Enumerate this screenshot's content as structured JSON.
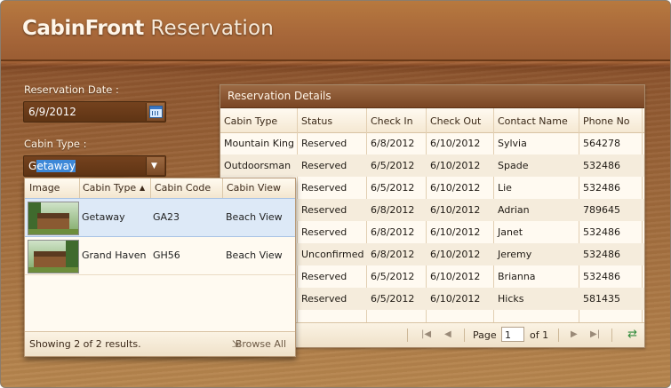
{
  "app": {
    "title_brand": "CabinFront",
    "title_rest": " Reservation"
  },
  "form": {
    "date_label": "Reservation Date :",
    "date_value": "6/9/2012",
    "cabin_label": "Cabin Type :",
    "cabin_value_prefix": "G",
    "cabin_value_selected": "etaway"
  },
  "dropdown": {
    "columns": [
      "Image",
      "Cabin Type",
      "Cabin Code",
      "Cabin View"
    ],
    "sort_icon": "sort-ascending-icon",
    "rows": [
      {
        "type": "Getaway",
        "code": "GA23",
        "view": "Beach View"
      },
      {
        "type": "Grand Haven",
        "code": "GH56",
        "view": "Beach View"
      }
    ],
    "status": "Showing 2 of 2 results.",
    "browse_label": "Browse All"
  },
  "panel": {
    "title": "Reservation Details",
    "columns": [
      "Cabin Type",
      "Status",
      "Check In",
      "Check Out",
      "Contact Name",
      "Phone No"
    ],
    "rows": [
      {
        "cabin": "Mountain King",
        "status": "Reserved",
        "in": "6/8/2012",
        "out": "6/10/2012",
        "contact": "Sylvia",
        "phone": "564278"
      },
      {
        "cabin": "Outdoorsman",
        "status": "Reserved",
        "in": "6/5/2012",
        "out": "6/10/2012",
        "contact": "Spade",
        "phone": "532486"
      },
      {
        "cabin": "",
        "status": "Reserved",
        "in": "6/5/2012",
        "out": "6/10/2012",
        "contact": "Lie",
        "phone": "532486"
      },
      {
        "cabin": "",
        "status": "Reserved",
        "in": "6/8/2012",
        "out": "6/10/2012",
        "contact": "Adrian",
        "phone": "789645"
      },
      {
        "cabin": "",
        "status": "Reserved",
        "in": "6/8/2012",
        "out": "6/10/2012",
        "contact": "Janet",
        "phone": "532486"
      },
      {
        "cabin": "",
        "status": "Unconfirmed",
        "in": "6/8/2012",
        "out": "6/10/2012",
        "contact": "Jeremy",
        "phone": "532486"
      },
      {
        "cabin": "",
        "status": "Reserved",
        "in": "6/5/2012",
        "out": "6/10/2012",
        "contact": "Brianna",
        "phone": "532486"
      },
      {
        "cabin": "",
        "status": "Reserved",
        "in": "6/5/2012",
        "out": "6/10/2012",
        "contact": "Hicks",
        "phone": "581435"
      }
    ],
    "pager": {
      "page_label": "Page",
      "page_value": "1",
      "of_label": "of 1"
    }
  },
  "colors": {
    "accent_selection": "#3d88d8",
    "wood": "#a86a3c",
    "panel_bg": "#fffaf1"
  }
}
